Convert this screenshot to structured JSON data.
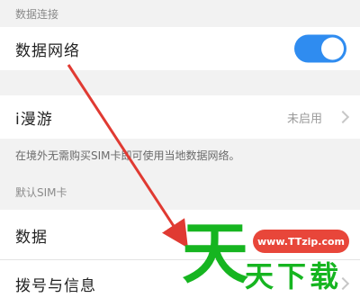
{
  "data_connection": {
    "header": "数据连接",
    "network_label": "数据网络",
    "network_enabled": true
  },
  "roaming": {
    "label": "i漫游",
    "status": "未启用",
    "description": "在境外无需购买SIM卡即可使用当地数据网络。"
  },
  "default_sim": {
    "header": "默认SIM卡",
    "data_label": "数据",
    "calls_label": "拨号与信息"
  },
  "watermark": {
    "site": "www.TTzip.com",
    "big_char": "天",
    "text": "天下载",
    "color": "#16b520",
    "badge_color": "#e8463a"
  },
  "accent_color": "#2f8cf0",
  "annotation_color": "#e03a32"
}
